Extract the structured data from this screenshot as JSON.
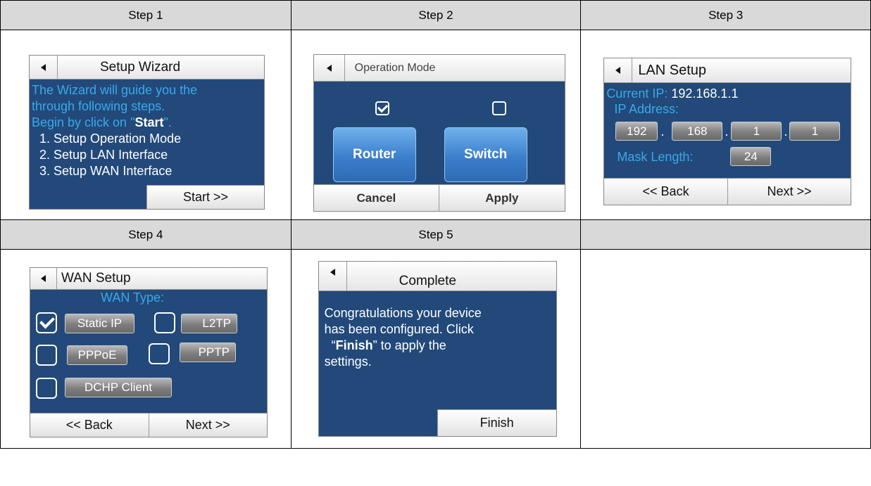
{
  "steps": {
    "s1": "Step 1",
    "s2": "Step 2",
    "s3": "Step 3",
    "s4": "Step 4",
    "s5": "Step 5"
  },
  "screen1": {
    "title": "Setup Wizard",
    "line1": "The Wizard will guide you the",
    "line2": "through following steps.",
    "line3_pre": "Begin by click on \"",
    "line3_bold": "Start",
    "line3_post": "\".",
    "items": [
      "1. Setup Operation Mode",
      "2. Setup LAN Interface",
      "3. Setup WAN Interface"
    ],
    "start": "Start >>"
  },
  "screen2": {
    "title": "Operation Mode",
    "router": "Router",
    "switch": "Switch",
    "cancel": "Cancel",
    "apply": "Apply"
  },
  "screen3": {
    "title": "LAN Setup",
    "current_ip_label": "Current IP:",
    "current_ip_value": "192.168.1.1",
    "ip_address_label": "IP Address:",
    "octets": [
      "192",
      "168",
      "1",
      "1"
    ],
    "mask_label": "Mask Length:",
    "mask_value": "24",
    "back": "<< Back",
    "next": "Next >>"
  },
  "screen4": {
    "title": "WAN Setup",
    "wan_type": "WAN Type:",
    "static_ip": "Static IP",
    "l2tp": "L2TP",
    "pppoe": "PPPoE",
    "pptp": "PPTP",
    "dhcp": "DCHP Client",
    "back": "<< Back",
    "next": "Next >>"
  },
  "screen5": {
    "title": "Complete",
    "line1": "Congratulations your device",
    "line2": "has been configured. Click",
    "line3_pre": "“",
    "line3_bold": "Finish",
    "line3_post": "”  to apply the",
    "line4": "settings.",
    "finish": "Finish"
  }
}
